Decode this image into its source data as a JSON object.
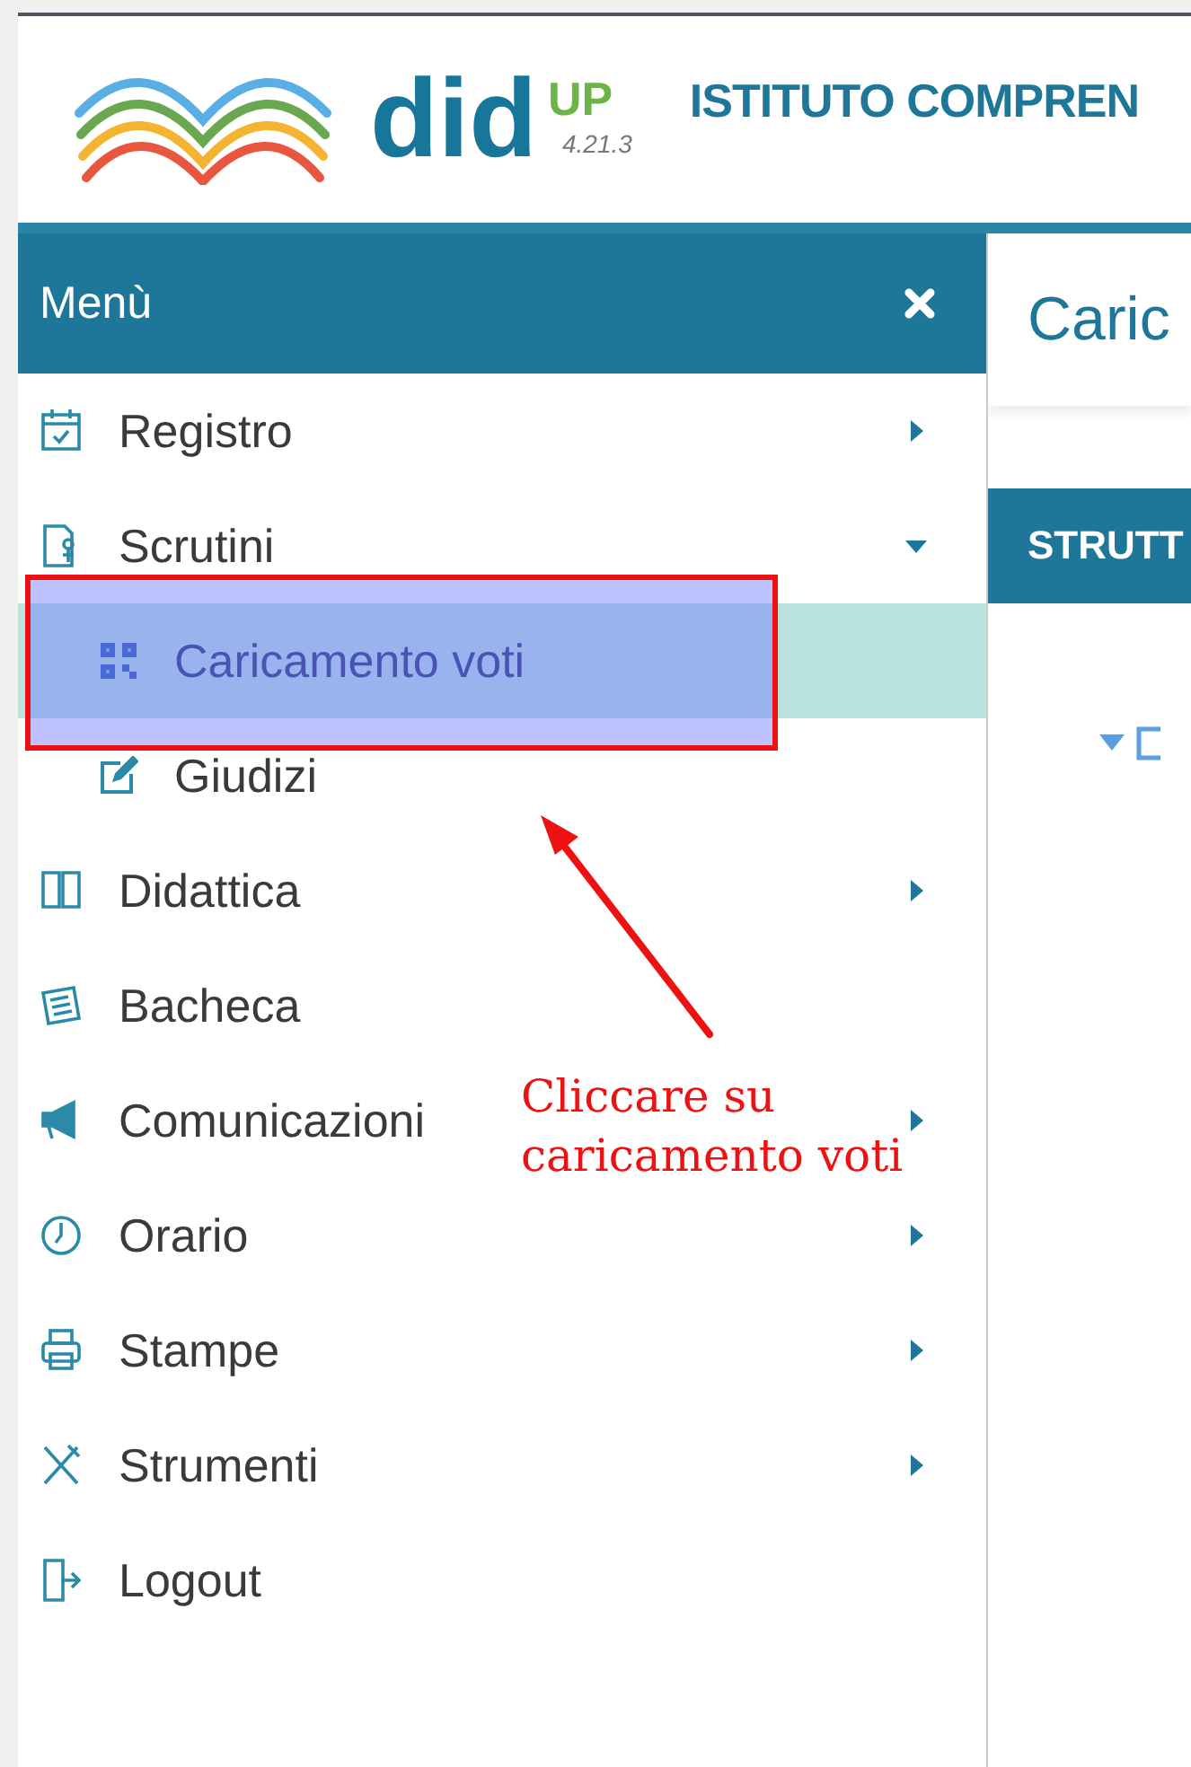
{
  "header": {
    "logo_word": "did",
    "logo_sup": "UP",
    "version": "4.21.3",
    "school": "ISTITUTO COMPREN"
  },
  "sidebar": {
    "title": "Menù",
    "items": [
      {
        "label": "Registro",
        "kind": "submenu",
        "expanded": false,
        "selected": false
      },
      {
        "label": "Scrutini",
        "kind": "submenu",
        "expanded": true,
        "selected": false,
        "children": [
          {
            "label": "Caricamento voti",
            "selected": true
          },
          {
            "label": "Giudizi",
            "selected": false
          }
        ]
      },
      {
        "label": "Didattica",
        "kind": "submenu",
        "expanded": false,
        "selected": false
      },
      {
        "label": "Bacheca",
        "kind": "link",
        "selected": false
      },
      {
        "label": "Comunicazioni",
        "kind": "submenu",
        "expanded": false,
        "selected": false
      },
      {
        "label": "Orario",
        "kind": "submenu",
        "expanded": false,
        "selected": false
      },
      {
        "label": "Stampe",
        "kind": "submenu",
        "expanded": false,
        "selected": false
      },
      {
        "label": "Strumenti",
        "kind": "submenu",
        "expanded": false,
        "selected": false
      },
      {
        "label": "Logout",
        "kind": "link",
        "selected": false
      }
    ]
  },
  "main": {
    "title": "Caric",
    "panel_header": "STRUTT"
  },
  "annotation": {
    "text": "Cliccare su caricamento voti"
  }
}
